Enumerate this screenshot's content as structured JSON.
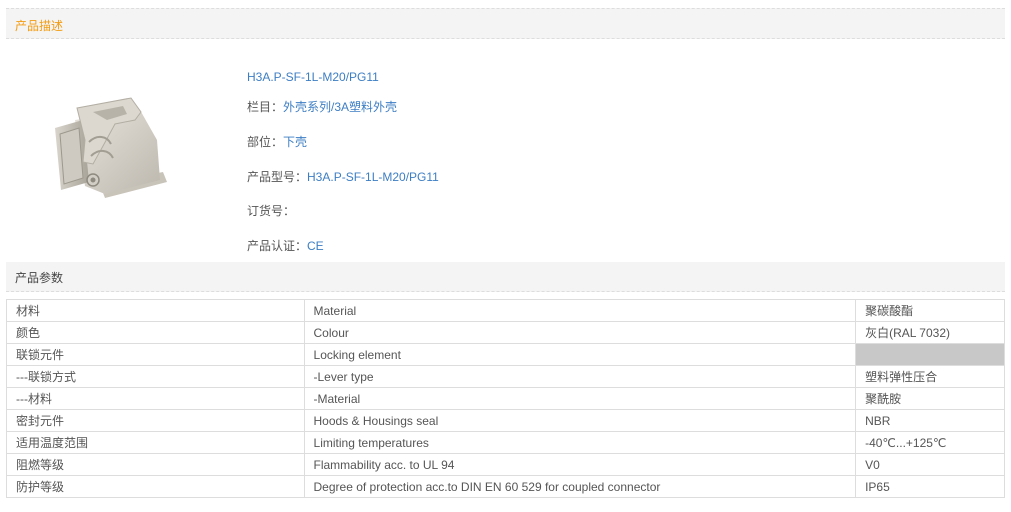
{
  "description_section": {
    "title": "产品描述"
  },
  "product": {
    "name": "H3A.P-SF-1L-M20/PG11",
    "category_label": "栏目：",
    "category_value": "外壳系列/3A塑料外壳",
    "part_label": "部位：",
    "part_value": "下壳",
    "model_label": "产品型号：",
    "model_value": "H3A.P-SF-1L-M20/PG11",
    "order_label": "订货号：",
    "order_value": "",
    "cert_label": "产品认证：",
    "cert_value": "CE",
    "image_icon": "connector-housing-photo"
  },
  "params_section": {
    "title": "产品参数"
  },
  "params": [
    {
      "cn": "材料",
      "en": "Material",
      "value": "聚碳酸酯"
    },
    {
      "cn": "颜色",
      "en": "Colour",
      "value": "灰白(RAL 7032)"
    },
    {
      "cn": "联锁元件",
      "en": "Locking element",
      "value": ""
    },
    {
      "cn": "---联锁方式",
      "en": "-Lever type",
      "value": "塑料弹性压合"
    },
    {
      "cn": "---材料",
      "en": "-Material",
      "value": "聚酰胺"
    },
    {
      "cn": "密封元件",
      "en": "Hoods & Housings seal",
      "value": "NBR"
    },
    {
      "cn": "适用温度范围",
      "en": "Limiting temperatures",
      "value": "-40℃...+125℃"
    },
    {
      "cn": "阻燃等级",
      "en": "Flammability acc. to UL 94",
      "value": "V0"
    },
    {
      "cn": "防护等级",
      "en": "Degree of protection acc.to DIN EN 60 529 for coupled connector",
      "value": "IP65"
    }
  ],
  "colors": {
    "accent_orange": "#f39c12",
    "link_blue": "#3d7ec3",
    "header_bg": "#f4f4f4",
    "empty_cell": "#c8c8c8"
  }
}
